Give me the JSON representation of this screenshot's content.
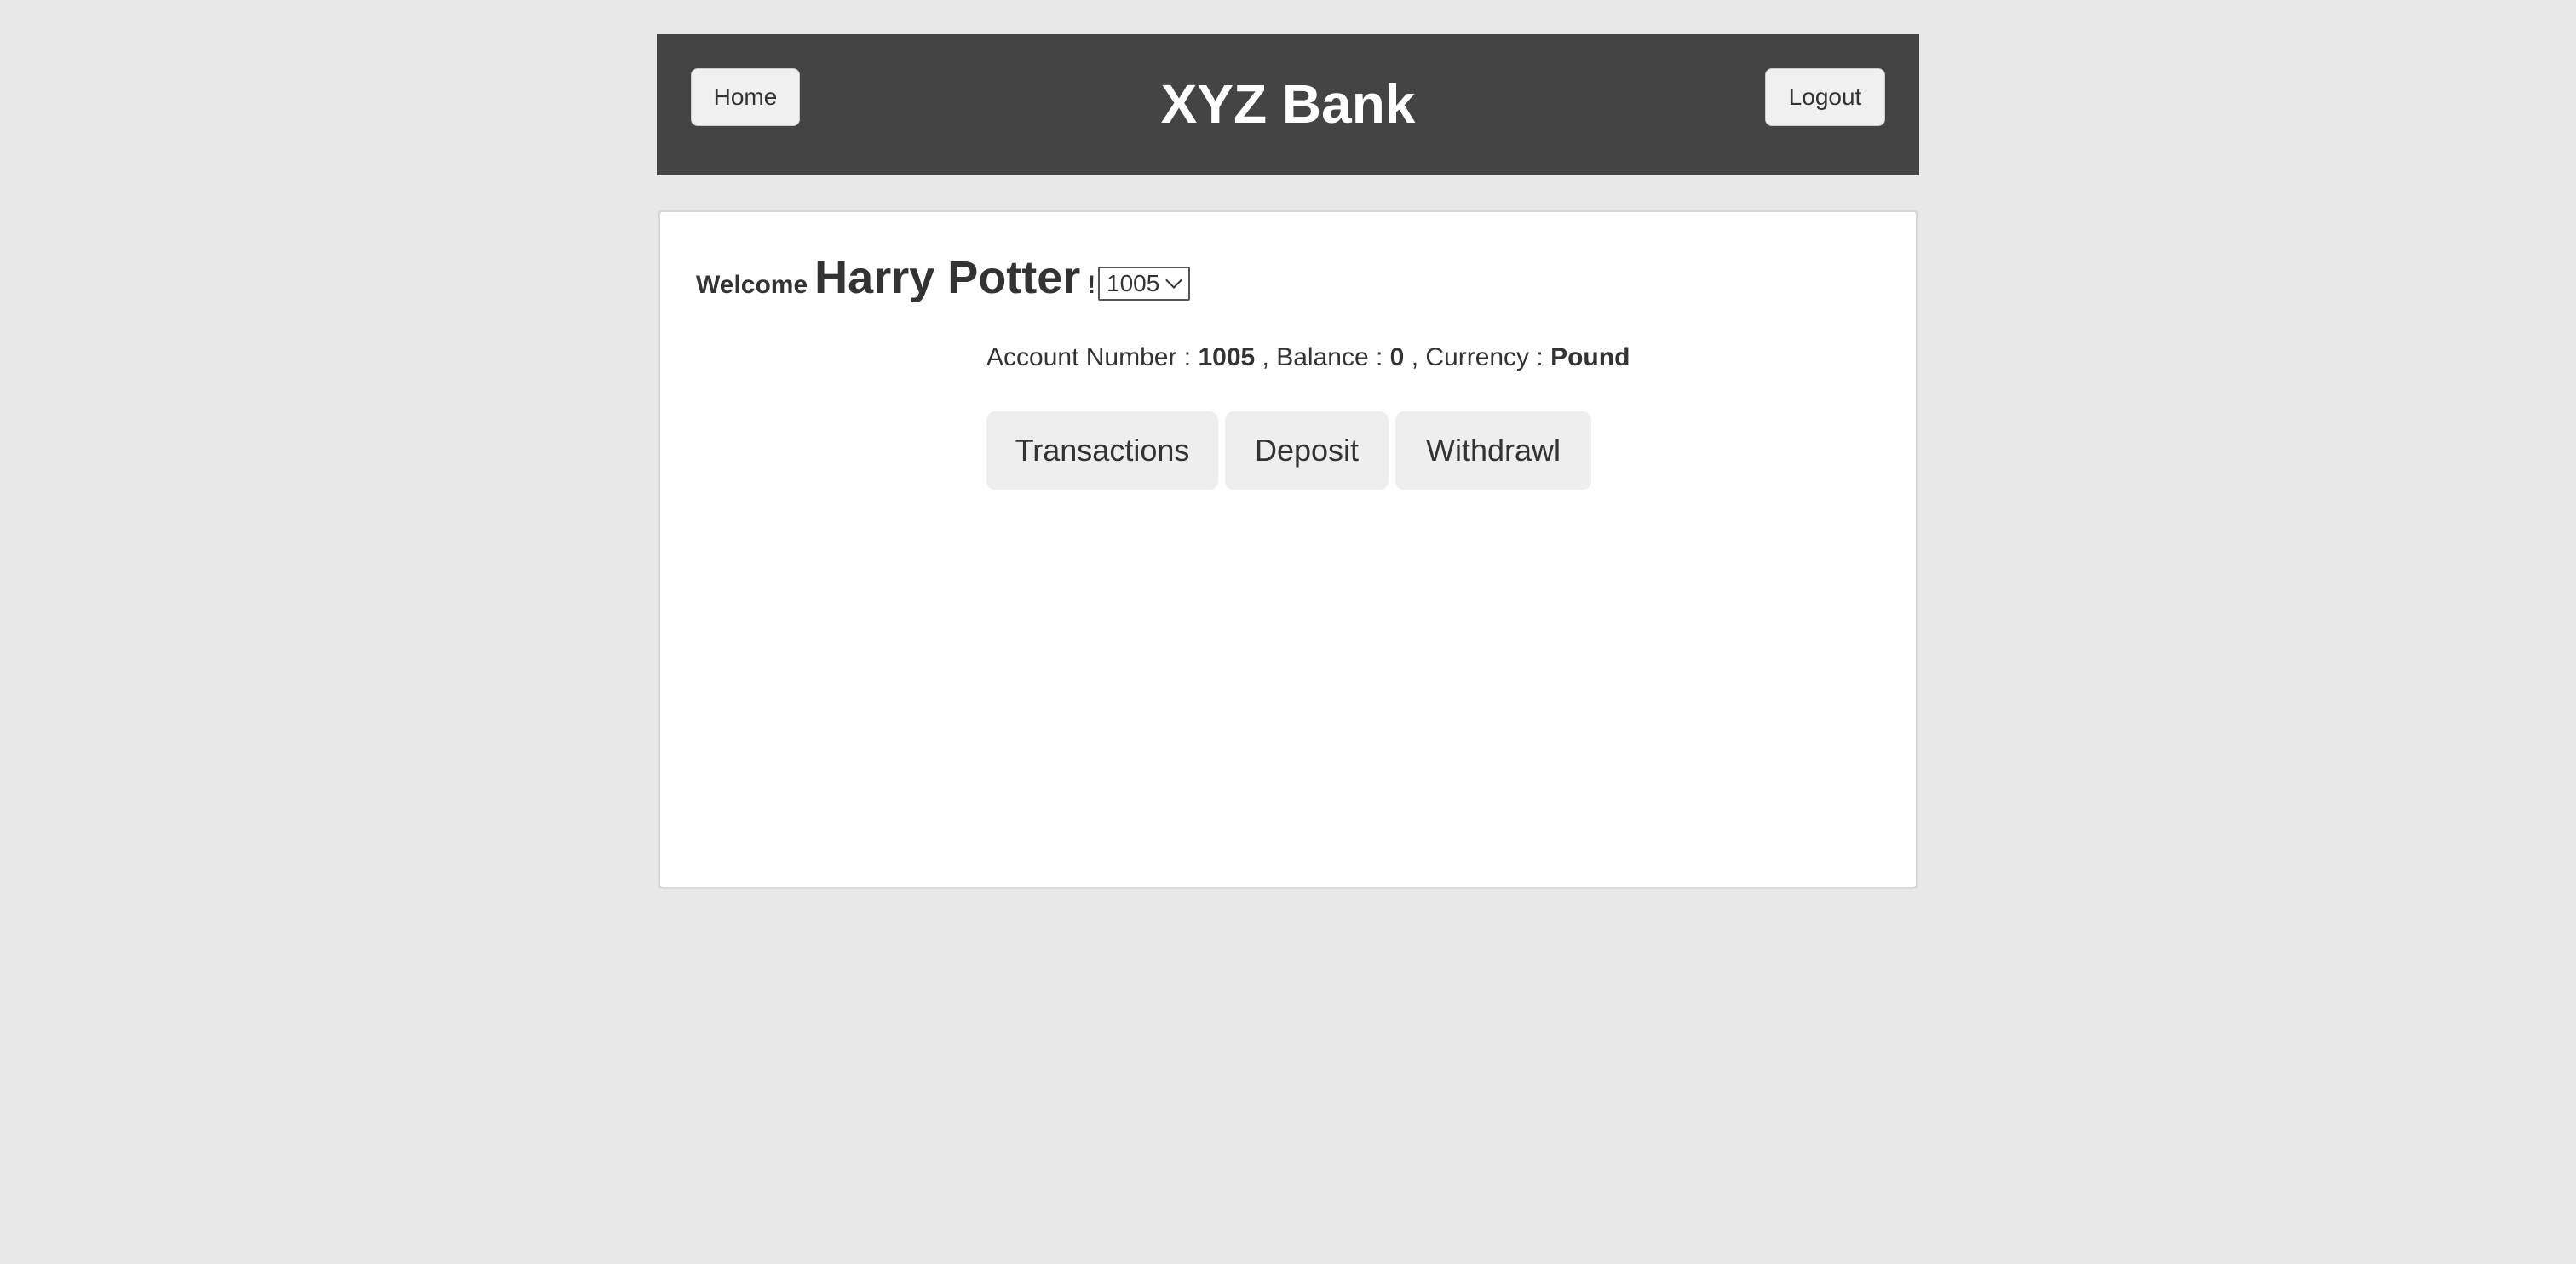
{
  "header": {
    "home_label": "Home",
    "title": "XYZ Bank",
    "logout_label": "Logout"
  },
  "welcome": {
    "prefix": "Welcome",
    "customer_name": "Harry Potter",
    "suffix": "!!"
  },
  "account_select": {
    "selected": "1005"
  },
  "account_info": {
    "number_label": "Account Number :",
    "number": "1005",
    "balance_label": ", Balance :",
    "balance": "0",
    "currency_label": ", Currency :",
    "currency": "Pound"
  },
  "actions": {
    "transactions_label": "Transactions",
    "deposit_label": "Deposit",
    "withdrawl_label": "Withdrawl"
  },
  "colors": {
    "header_bg": "#444444",
    "page_bg": "#e8e8e8",
    "panel_bg": "#ffffff",
    "button_bg": "#eeeeee"
  }
}
